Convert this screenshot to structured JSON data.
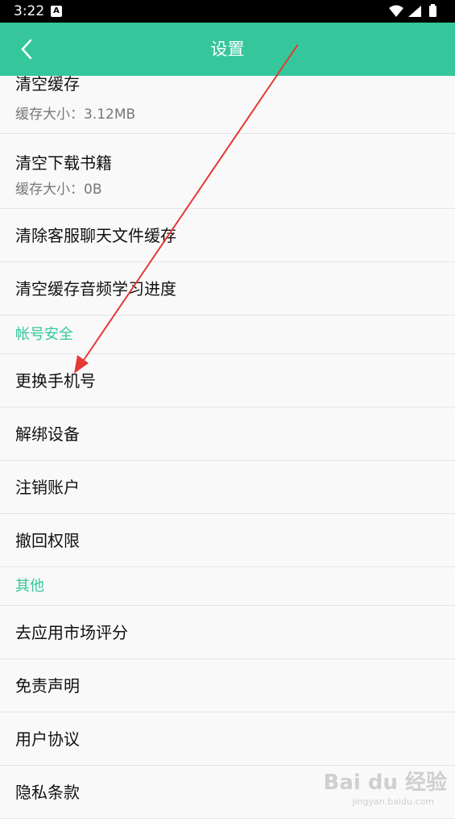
{
  "status": {
    "time": "3:22",
    "notif": "A"
  },
  "header": {
    "title": "设置"
  },
  "cache": {
    "clear_cache": {
      "label": "清空缓存",
      "sub": "缓存大小：3.12MB"
    },
    "clear_books": {
      "label": "清空下载书籍",
      "sub": "缓存大小：0B"
    },
    "clear_chat": {
      "label": "清除客服聊天文件缓存"
    },
    "clear_audio": {
      "label": "清空缓存音频学习进度"
    }
  },
  "account": {
    "section": "帐号安全",
    "items": [
      "更换手机号",
      "解绑设备",
      "注销账户",
      "撤回权限"
    ]
  },
  "other": {
    "section": "其他",
    "items": [
      "去应用市场评分",
      "免责声明",
      "用户协议",
      "隐私条款"
    ]
  },
  "watermark": {
    "text": "Bai du 经验",
    "sub": "jingyan.baidu.com"
  },
  "colors": {
    "accent": "#35c79b",
    "arrow": "#e53935"
  }
}
